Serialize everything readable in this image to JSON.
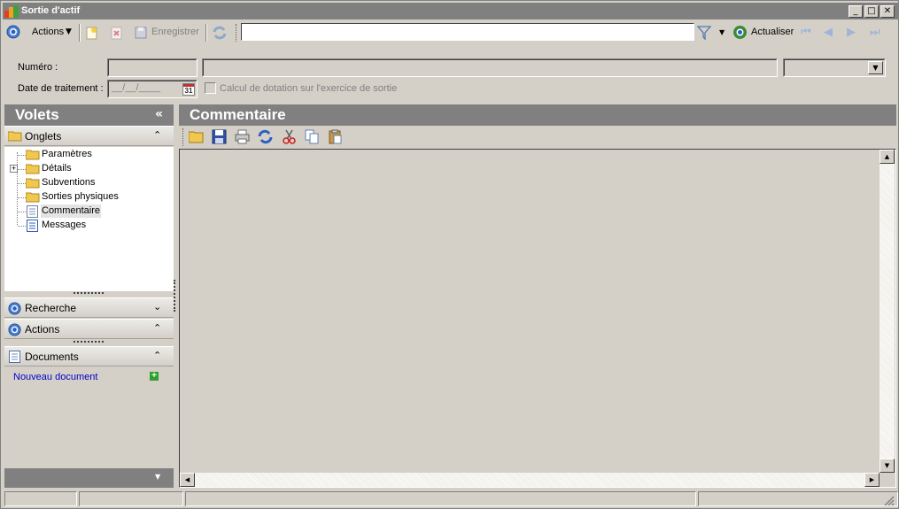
{
  "window": {
    "title": "Sortie d'actif",
    "controls": [
      "minimize",
      "maximize",
      "close"
    ]
  },
  "toolbar": {
    "actions_label": "Actions",
    "save_label": "Enregistrer",
    "filter_value": "",
    "refresh_label": "Actualiser"
  },
  "header": {
    "numero_label": "Numéro :",
    "numero_value": "",
    "description_value": "",
    "type_select_value": "",
    "date_label": "Date de traitement :",
    "date_placeholder": "__/__/____",
    "calendar_day": "31",
    "dotation_checkbox_label": "Calcul de dotation sur l'exercice de sortie",
    "dotation_checked": false
  },
  "left_panel": {
    "title": "Volets",
    "collapse_glyph": "«",
    "onglets": {
      "title": "Onglets",
      "items": [
        {
          "label": "Paramètres",
          "icon": "folder-icon",
          "expandable": false,
          "selected": false
        },
        {
          "label": "Détails",
          "icon": "folder-icon",
          "expandable": true,
          "selected": false
        },
        {
          "label": "Subventions",
          "icon": "folder-icon",
          "expandable": false,
          "selected": false
        },
        {
          "label": "Sorties physiques",
          "icon": "folder-icon",
          "expandable": false,
          "selected": false
        },
        {
          "label": "Commentaire",
          "icon": "document-icon",
          "expandable": false,
          "selected": true
        },
        {
          "label": "Messages",
          "icon": "document-icon",
          "expandable": false,
          "selected": false
        }
      ]
    },
    "recherche": {
      "title": "Recherche"
    },
    "actions": {
      "title": "Actions"
    },
    "documents": {
      "title": "Documents",
      "new_document_label": "Nouveau document"
    }
  },
  "right_panel": {
    "title": "Commentaire",
    "toolbar_icons": [
      "open-folder-icon",
      "save-icon",
      "print-icon",
      "refresh-icon",
      "cut-icon",
      "copy-icon",
      "paste-icon"
    ],
    "content": ""
  },
  "colors": {
    "chrome": "#d4d0c8",
    "header_gray": "#808080",
    "link_blue": "#0000cc",
    "accent_blue": "#2060c0"
  }
}
